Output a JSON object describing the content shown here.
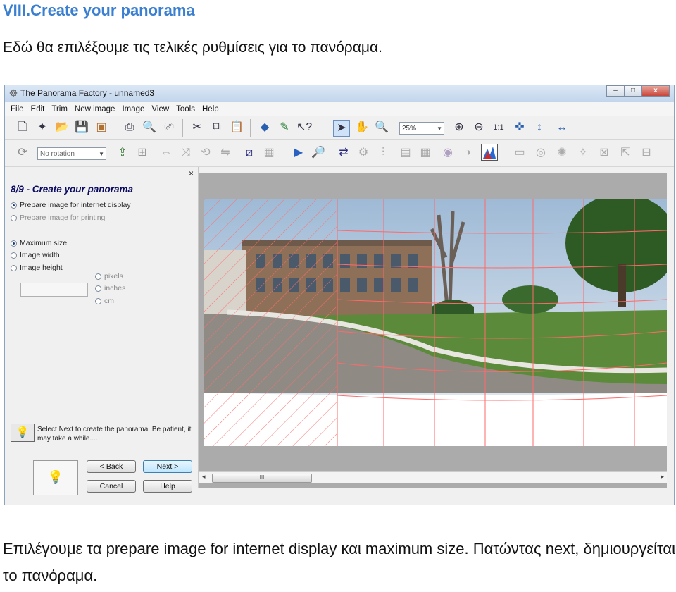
{
  "document": {
    "heading": "VIII.Create your panorama",
    "intro": "Εδώ θα επιλέξουμε τις τελικές ρυθμίσεις για το πανόραμα.",
    "caption": "Επιλέγουμε τα prepare image for internet display και maximum size. Πατώντας next, δημιουργείται το πανόραμα."
  },
  "window": {
    "title": "The Panorama Factory - unnamed3",
    "controls": {
      "minimize": "–",
      "maximize": "□",
      "close": "x"
    }
  },
  "menu": [
    "File",
    "Edit",
    "Trim",
    "New image",
    "Image",
    "View",
    "Tools",
    "Help"
  ],
  "toolbar": {
    "zoom_value": "25%",
    "rotation_value": "No rotation"
  },
  "panel": {
    "close": "×",
    "title": "8/9 - Create your panorama",
    "target_options": [
      {
        "label": "Prepare image for internet display",
        "selected": true,
        "enabled": true
      },
      {
        "label": "Prepare image for printing",
        "selected": false,
        "enabled": false
      }
    ],
    "size_options": [
      {
        "label": "Maximum size",
        "selected": true
      },
      {
        "label": "Image width",
        "selected": false
      },
      {
        "label": "Image height",
        "selected": false
      }
    ],
    "unit_options": [
      "pixels",
      "inches",
      "cm"
    ],
    "hint": "Select Next to create the panorama.  Be patient, it may take a while....",
    "buttons": {
      "back": "< Back",
      "next": "Next >",
      "cancel": "Cancel",
      "help": "Help"
    }
  },
  "scrollbar": {
    "thumb": "III"
  },
  "colors": {
    "heading": "#3a7fd0",
    "grid_line": "#ff6a6a",
    "sky": "#b9cde0",
    "grass": "#5b8a3a",
    "pavement": "#8f8b84",
    "building": "#8e6f57"
  }
}
